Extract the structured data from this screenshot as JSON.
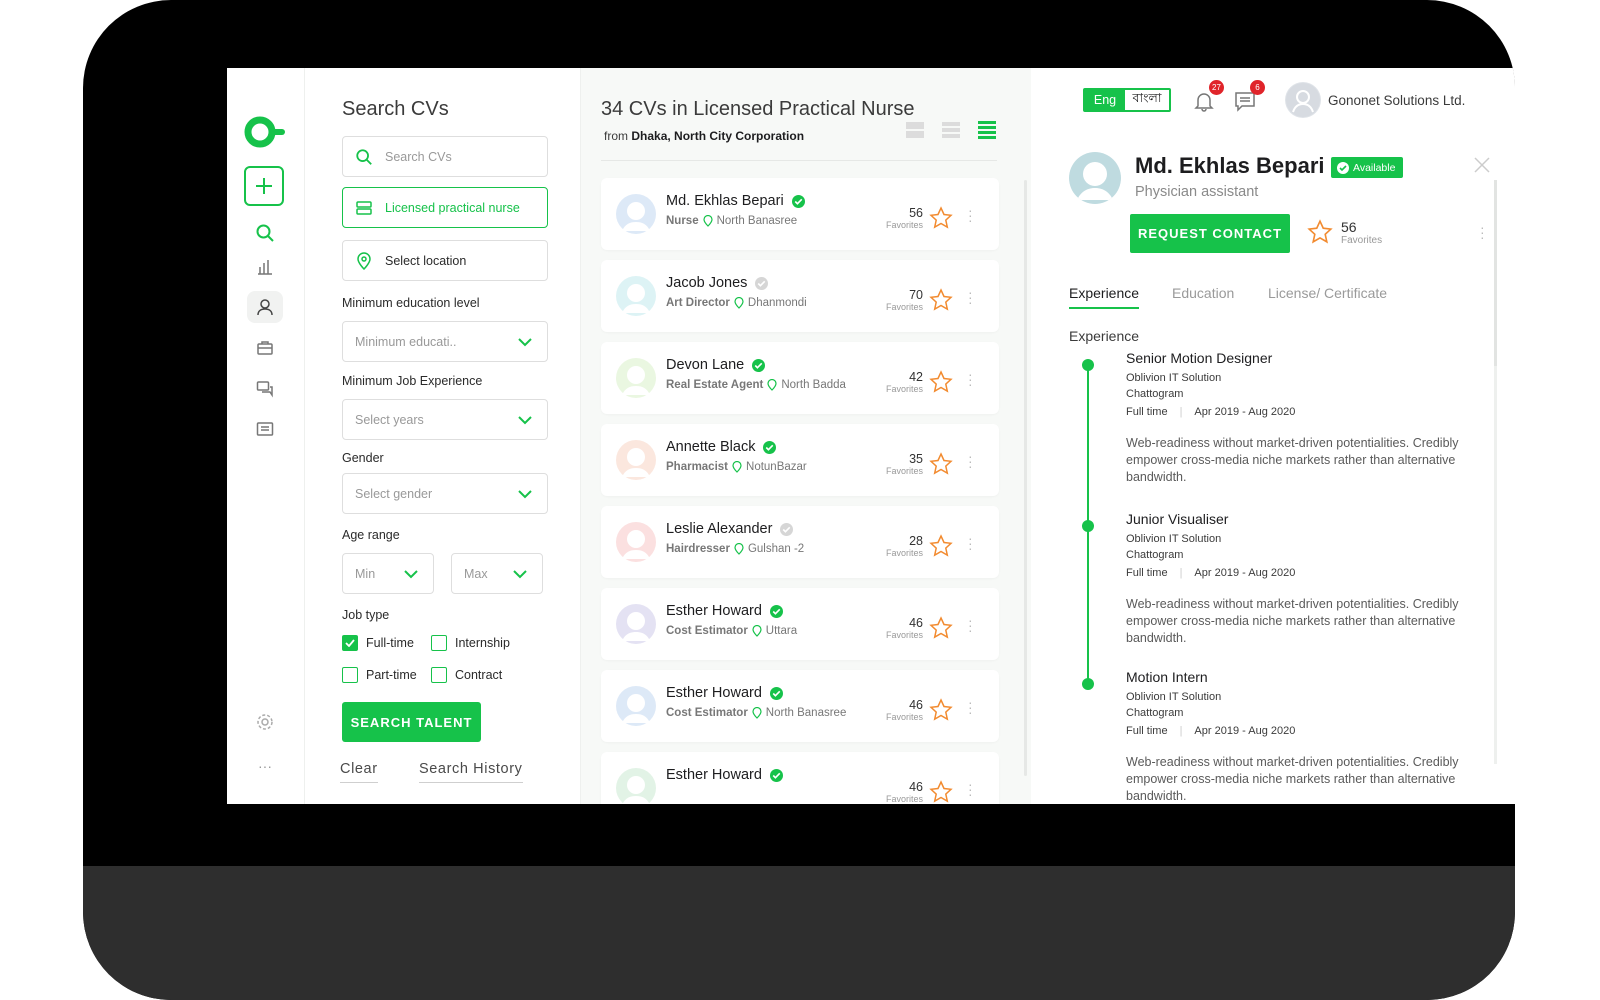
{
  "filters": {
    "title": "Search CVs",
    "search_placeholder": "Search CVs",
    "keyword_value": "Licensed practical nurse",
    "location_value": "Select location",
    "education_label": "Minimum education level",
    "education_placeholder": "Minimum educati..",
    "experience_label": "Minimum Job Experience",
    "experience_placeholder": "Select years",
    "gender_label": "Gender",
    "gender_placeholder": "Select gender",
    "age_label": "Age range",
    "age_min": "Min",
    "age_max": "Max",
    "jobtype_label": "Job type",
    "jobtypes": [
      {
        "label": "Full-time",
        "checked": true
      },
      {
        "label": "Internship",
        "checked": false
      },
      {
        "label": "Part-time",
        "checked": false
      },
      {
        "label": "Contract",
        "checked": false
      }
    ],
    "search_button": "SEARCH TALENT",
    "clear": "Clear",
    "history": "Search History"
  },
  "list": {
    "title": "34 CVs in Licensed Practical Nurse",
    "from_prefix": "from",
    "from_location": "Dhaka, North City Corporation",
    "favorites_label": "Favorites",
    "candidates": [
      {
        "name": "Md. Ekhlas Bepari",
        "role": "Nurse",
        "location": "North Banasree",
        "favorites": "56",
        "verified": true,
        "avatar_color": "#dde9f7"
      },
      {
        "name": "Jacob Jones",
        "role": "Art Director",
        "location": "Dhanmondi",
        "favorites": "70",
        "verified": false,
        "avatar_color": "#ddf3f5"
      },
      {
        "name": "Devon Lane",
        "role": "Real Estate Agent",
        "location": "North Badda",
        "favorites": "42",
        "verified": true,
        "avatar_color": "#eaf7e1"
      },
      {
        "name": "Annette Black",
        "role": "Pharmacist",
        "location": "NotunBazar",
        "favorites": "35",
        "verified": true,
        "avatar_color": "#fbe7de"
      },
      {
        "name": "Leslie Alexander",
        "role": "Hairdresser",
        "location": "Gulshan -2",
        "favorites": "28",
        "verified": false,
        "avatar_color": "#fbe0e0"
      },
      {
        "name": "Esther Howard",
        "role": "Cost Estimator",
        "location": "Uttara",
        "favorites": "46",
        "verified": true,
        "avatar_color": "#e4e2f3"
      },
      {
        "name": "Esther Howard",
        "role": "Cost Estimator",
        "location": "North Banasree",
        "favorites": "46",
        "verified": true,
        "avatar_color": "#dde9f7"
      },
      {
        "name": "Esther Howard",
        "role": "",
        "location": "",
        "favorites": "46",
        "verified": true,
        "avatar_color": "#e2f3e6"
      }
    ]
  },
  "header": {
    "lang_en": "Eng",
    "lang_bn": "বাংলা",
    "notifications_count": "27",
    "messages_count": "6",
    "company": "Gononet Solutions Ltd."
  },
  "profile": {
    "name": "Md. Ekhlas Bepari",
    "status": "Available",
    "title": "Physician assistant",
    "request_button": "REQUEST CONTACT",
    "favorites": "56",
    "favorites_label": "Favorites",
    "tabs": [
      "Experience",
      "Education",
      "License/ Certificate"
    ],
    "section_title": "Experience",
    "experience": [
      {
        "title": "Senior Motion Designer",
        "company": "Oblivion IT Solution",
        "location": "Chattogram",
        "type": "Full time",
        "period": "Apr 2019 - Aug 2020",
        "description": "Web-readiness without market-driven potentialities. Credibly empower cross-media niche markets rather than alternative bandwidth."
      },
      {
        "title": "Junior Visualiser",
        "company": "Oblivion IT Solution",
        "location": "Chattogram",
        "type": "Full time",
        "period": "Apr 2019 - Aug 2020",
        "description": "Web-readiness without market-driven potentialities. Credibly empower cross-media niche markets rather than alternative bandwidth."
      },
      {
        "title": "Motion Intern",
        "company": "Oblivion IT Solution",
        "location": "Chattogram",
        "type": "Full time",
        "period": "Apr 2019 - Aug 2020",
        "description": "Web-readiness without market-driven potentialities. Credibly empower cross-media niche markets rather than alternative bandwidth."
      }
    ]
  },
  "colors": {
    "accent": "#16c24a",
    "star": "#f28b30",
    "badge": "#e0242a"
  }
}
